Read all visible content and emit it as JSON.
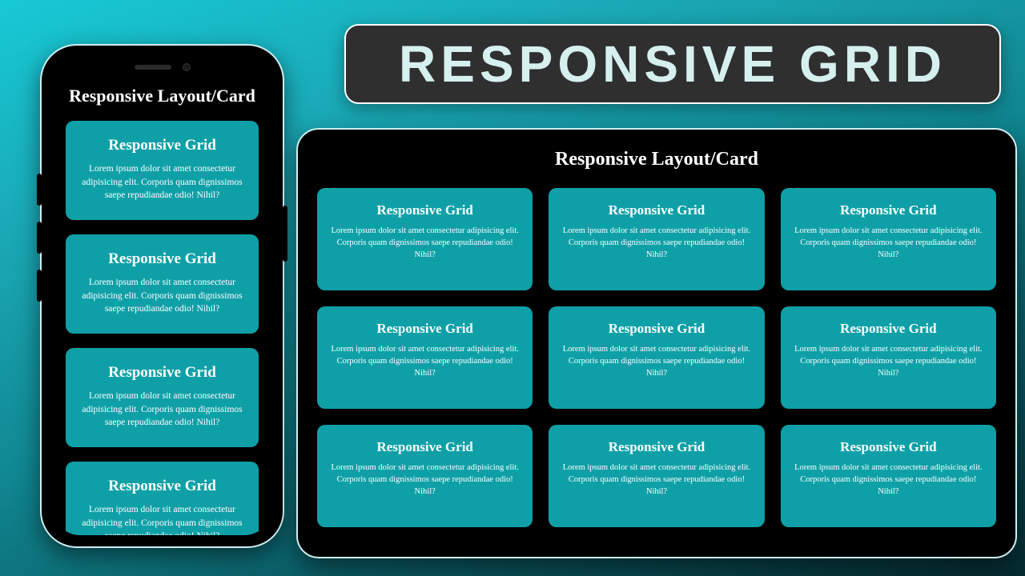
{
  "title_badge": "RESPONSIVE GRID",
  "heading": "Responsive Layout/Card",
  "card_title": "Responsive Grid",
  "card_body": "Lorem ipsum dolor sit amet consectetur adipisicing elit. Corporis quam dignissimos saepe repudiandae odio! Nihil?",
  "colors": {
    "card_bg": "#0fa0a7",
    "badge_bg": "#2f2f2f",
    "device_bg": "#000000"
  },
  "phone": {
    "card_count": 4
  },
  "tablet": {
    "card_count": 9
  }
}
